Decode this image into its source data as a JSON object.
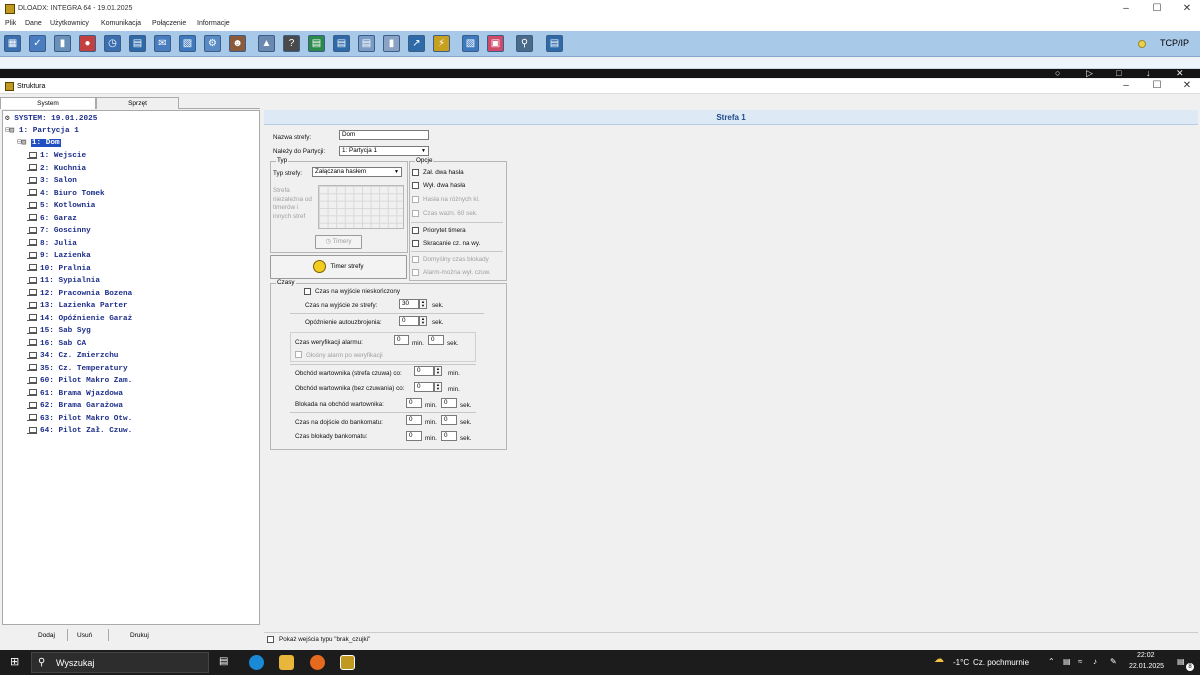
{
  "app": {
    "title": "DLOADX: INTEGRA 64 - 19.01.2025"
  },
  "menu": [
    "Plik",
    "Dane",
    "Użytkownicy",
    "Komunikacja",
    "Połączenie",
    "Informacje"
  ],
  "connection": {
    "label": "TCP/IP",
    "status_color": "#ead24a"
  },
  "struct_window": {
    "title": "Struktura"
  },
  "tabs": [
    "System",
    "Sprzęt"
  ],
  "tree": {
    "root": "SYSTEM: 19.01.2025",
    "partition": "1: Partycja 1",
    "zone_group": "1: Dom",
    "items": [
      "1: Wejscie",
      "2: Kuchnia",
      "3: Salon",
      "4: Biuro Tomek",
      "5: Kotlownia",
      "6: Garaz",
      "7: Goscinny",
      "8: Julia",
      "9: Lazienka",
      "10: Pralnia",
      "11: Sypialnia",
      "12: Pracownia Bozena",
      "13: Lazienka Parter",
      "14: Opóźnienie Garaż",
      "15: Sab Syg",
      "16: Sab CA",
      "34: Cz. Zmierzchu",
      "35: Cz. Temperatury",
      "60: Pilot Makro Zam.",
      "61: Brama Wjazdowa",
      "62: Brama Garażowa",
      "63: Pilot Makro Otw.",
      "64: Pilot Zał. Czuw."
    ]
  },
  "tree_buttons": [
    "Dodaj",
    "Usuń",
    "Drukuj"
  ],
  "panel": {
    "header": "Strefa 1",
    "zone_name_label": "Nazwa strefy:",
    "zone_name": "Dom",
    "belongs_label": "Należy do Partycji:",
    "belongs_value": "1: Partycja 1",
    "typ_group": "Typ",
    "typ_label": "Typ strefy:",
    "typ_value": "Załączana hasłem",
    "independent_text": [
      "Strefa",
      "niezależna od",
      "timerów i",
      "innych stref"
    ],
    "timers_btn": "Timery",
    "timer_strefy_btn": "Timer strefy",
    "opcje_group": "Opcje",
    "opcje": [
      {
        "label": "Zał. dwa hasła",
        "enabled": true
      },
      {
        "label": "Wył. dwa hasła",
        "enabled": true
      },
      {
        "label": "Hasła na różnych kl.",
        "enabled": false
      },
      {
        "label": "Czas wazn. 60 sek.",
        "enabled": false
      },
      {
        "label": "Priorytet timera",
        "enabled": true
      },
      {
        "label": "Skracanie cz. na wy.",
        "enabled": true
      },
      {
        "label": "Domyślny czas blokady",
        "enabled": false
      },
      {
        "label": "Alarm-można wył. czuw.",
        "enabled": false
      }
    ],
    "czasy_group": "Czasy",
    "exit_infinite": "Czas na wyjście nieskończony",
    "exit_time_label": "Czas na wyjście ze strefy:",
    "exit_time": "30",
    "auto_rearm_label": "Opóźnienie autouzbrojenia:",
    "auto_rearm": "0",
    "verify_label": "Czas weryfikacji alarmu:",
    "verify_min": "0",
    "verify_sec": "0",
    "loud_alarm": "Głośny alarm po weryfikacji",
    "guard_armed_label": "Obchód wartownika (strefa czuwa) co:",
    "guard_armed": "0",
    "guard_unarmed_label": "Obchód wartownika (bez czuwania) co:",
    "guard_unarmed": "0",
    "guard_block_label": "Blokada na obchód wartownika:",
    "guard_block_min": "0",
    "guard_block_sec": "0",
    "atm_access_label": "Czas na dojście do bankomatu:",
    "atm_access_min": "0",
    "atm_access_sec": "0",
    "atm_block_label": "Czas blokady bankomatu:",
    "atm_block_min": "0",
    "atm_block_sec": "0",
    "unit_min": "min.",
    "unit_sec": "sek.",
    "show_inputs": "Pokaż wejścia typu \"brak_czujki\""
  },
  "taskbar": {
    "search": "Wyszukaj",
    "weather_temp": "-1°C",
    "weather_text": "Cz. pochmurnie",
    "time": "22:02",
    "date": "22.01.2025",
    "notification_count": "8"
  }
}
